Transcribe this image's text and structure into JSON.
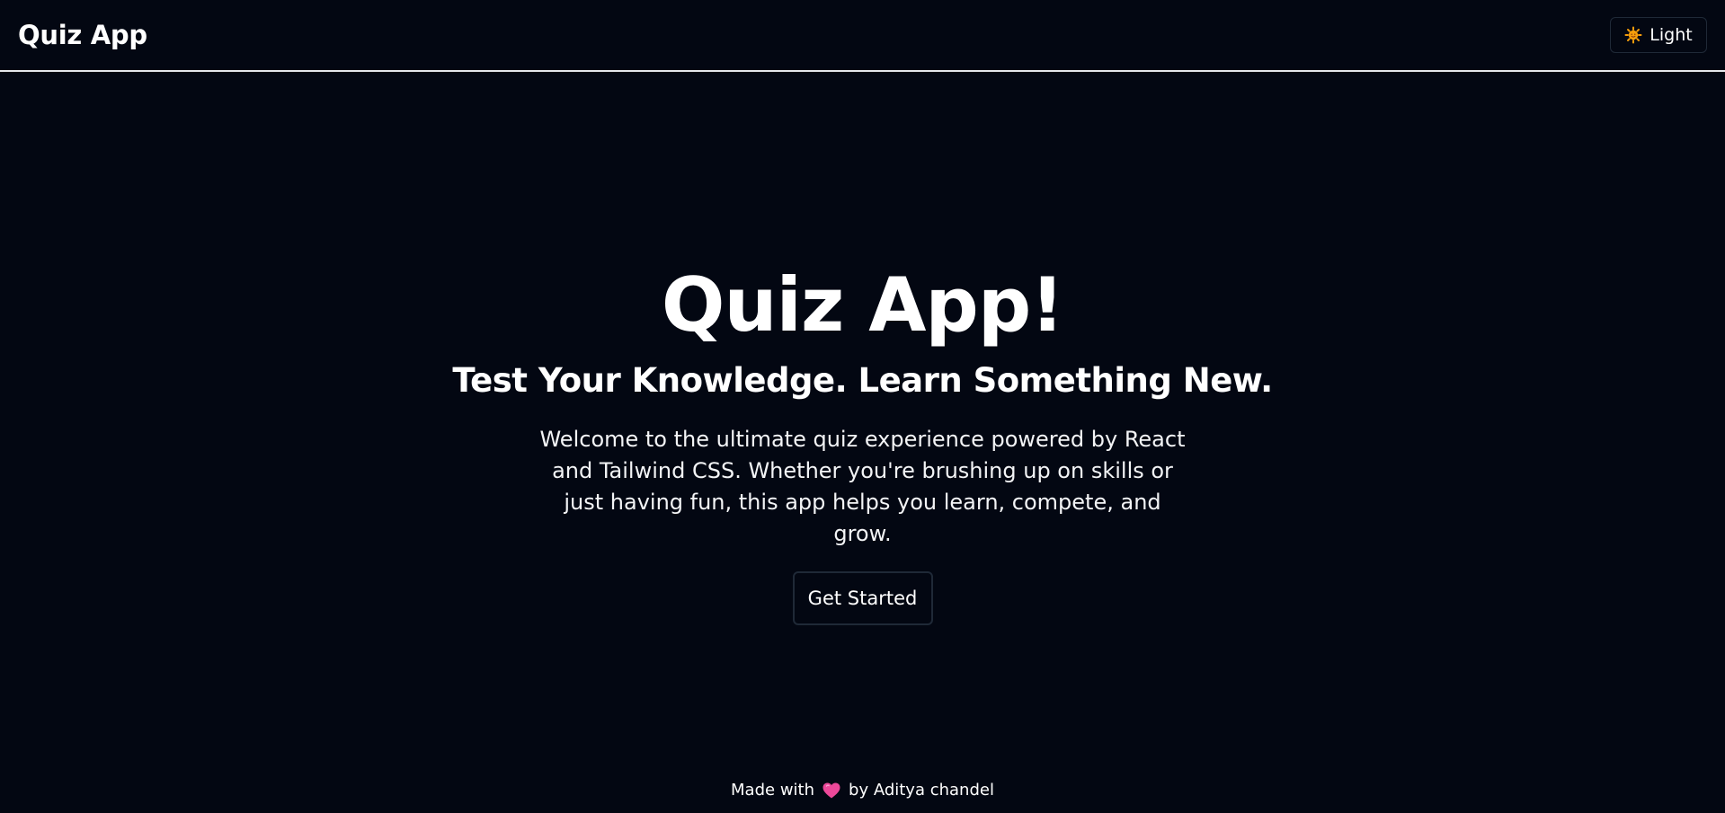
{
  "header": {
    "brand": "Quiz App",
    "theme_toggle": {
      "icon": "sun-icon",
      "label": "Light"
    }
  },
  "hero": {
    "title": "Quiz App!",
    "subtitle": "Test Your Knowledge. Learn Something New.",
    "description": "Welcome to the ultimate quiz experience powered by React and Tailwind CSS. Whether you're brushing up on skills or just having fun, this app helps you learn, compete, and grow.",
    "cta_label": "Get Started"
  },
  "footer": {
    "before_icon": "Made with",
    "icon": "heart-icon",
    "after_icon": "by Aditya chandel"
  },
  "colors": {
    "background": "#030712",
    "text": "#ffffff",
    "border": "#e5e7eb",
    "button_border": "#1f2937",
    "heart": "#ec4899",
    "sun": "#f59e0b"
  }
}
